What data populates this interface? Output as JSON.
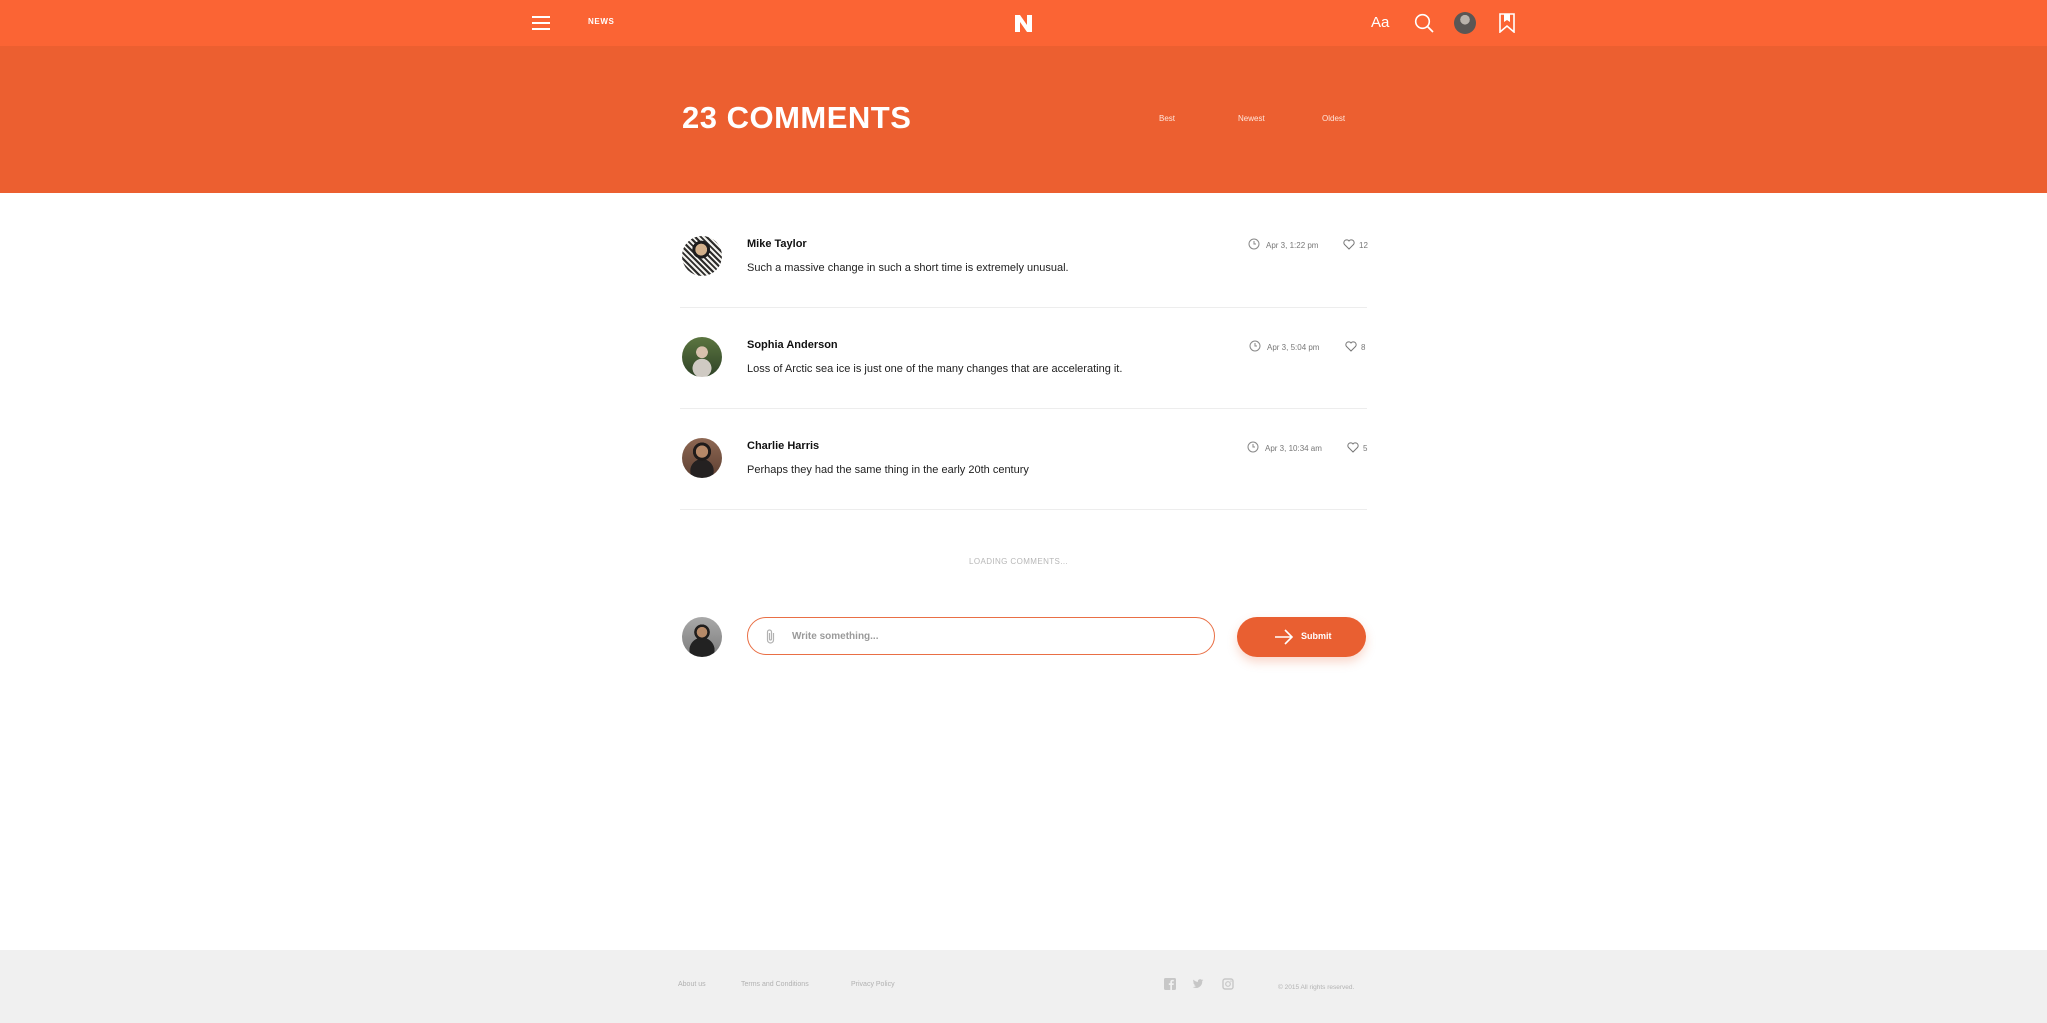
{
  "header": {
    "nav_label": "NEWS",
    "brand_color": "#fb6434"
  },
  "comments_header": {
    "title": "23 COMMENTS",
    "sort_options": [
      "Best",
      "Newest",
      "Oldest"
    ]
  },
  "comments": [
    {
      "author": "Mike Taylor",
      "text": "Such a massive change in such a short time is extremely unusual.",
      "time": "Apr 3, 1:22 pm",
      "likes": "12"
    },
    {
      "author": "Sophia Anderson",
      "text": "Loss of Arctic sea ice is just one of the many changes that are accelerating it.",
      "time": "Apr 3, 5:04 pm",
      "likes": "8"
    },
    {
      "author": "Charlie Harris",
      "text": "Perhaps they had the same thing in the early 20th century",
      "time": "Apr 3, 10:34 am",
      "likes": "5"
    }
  ],
  "loading_text": "LOADING COMMENTS...",
  "composer": {
    "placeholder": "Write something...",
    "submit_label": "Submit"
  },
  "footer": {
    "links": [
      "About us",
      "Terms and Conditions",
      "Privacy Policy"
    ],
    "copyright": "© 2015 All rights reserved."
  },
  "colors": {
    "accent": "#ec5f30",
    "footer_bg": "#f0f0f0"
  },
  "icons": {
    "menu": "menu-icon",
    "font": "font-size-icon",
    "search": "search-icon",
    "bookmark": "bookmark-icon",
    "time": "clock-icon",
    "like": "heart-icon",
    "attach": "paperclip-icon",
    "submit": "arrow-right-icon",
    "social": [
      "facebook-icon",
      "twitter-icon",
      "instagram-icon"
    ]
  }
}
